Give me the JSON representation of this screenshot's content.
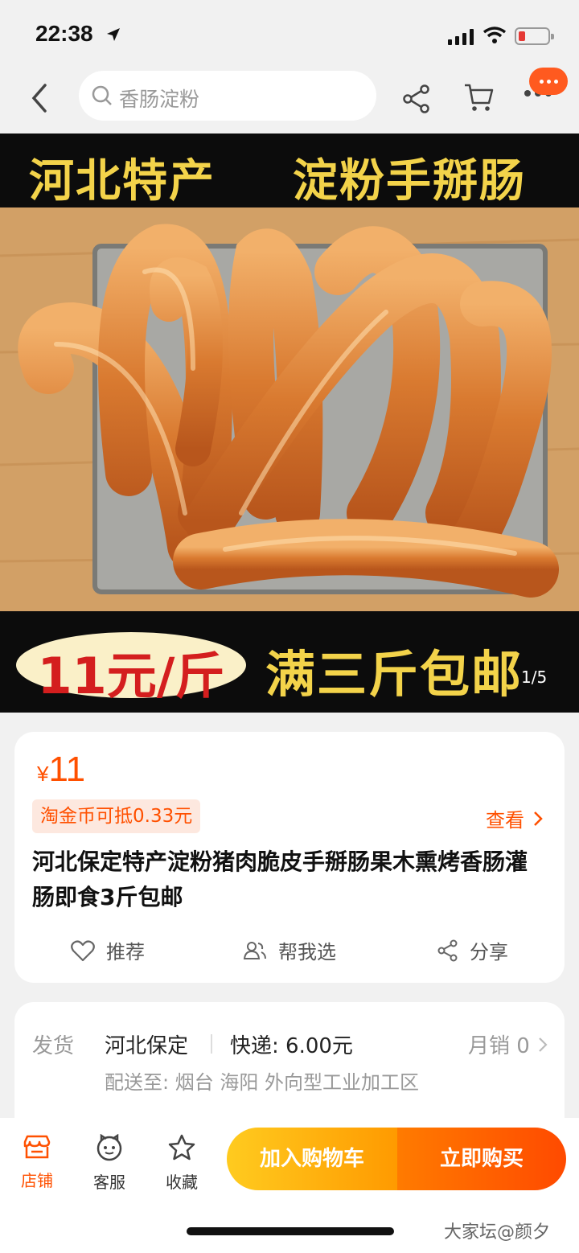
{
  "status": {
    "time": "22:38"
  },
  "search": {
    "placeholder": "香肠淀粉"
  },
  "hero": {
    "banner_left": "河北特产",
    "banner_right": "淀粉手掰肠",
    "price_tag": "11元/斤",
    "shipping_promo": "满三斤包邮",
    "pager": "1/5"
  },
  "product": {
    "currency": "¥",
    "price": "11",
    "coin_offer": "淘金币可抵0.33元",
    "view_label": "查看",
    "title": "河北保定特产淀粉猪肉脆皮手掰肠果木熏烤香肠灌肠即食3斤包邮",
    "actions": {
      "recommend": "推荐",
      "help_choose": "帮我选",
      "share": "分享"
    }
  },
  "shipping": {
    "label": "发货",
    "origin": "河北保定",
    "express": "快递: 6.00元",
    "monthly_sales": "月销 0",
    "destination": "配送至: 烟台 海阳 外向型工业加工区"
  },
  "bottom_bar": {
    "store": "店铺",
    "service": "客服",
    "favorite": "收藏",
    "add_to_cart": "加入购物车",
    "buy_now": "立即购买"
  },
  "watermark": "大家坛@颜夕",
  "colors": {
    "accent": "#ff5000",
    "banner_text": "#f3d34a"
  }
}
